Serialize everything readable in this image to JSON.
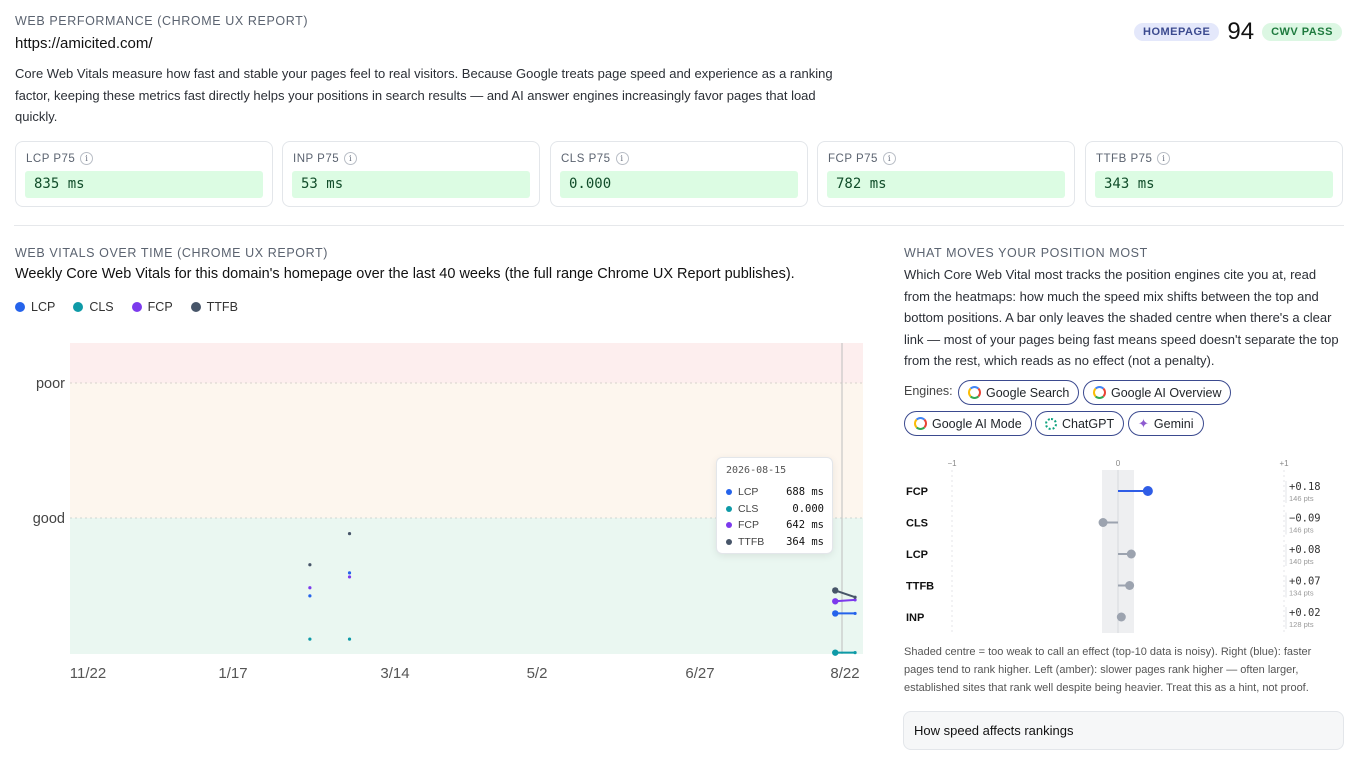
{
  "header": {
    "eyebrow": "WEB PERFORMANCE (CHROME UX REPORT)",
    "url": "https://amicited.com/",
    "badge_homepage": "HOMEPAGE",
    "score": "94",
    "badge_status": "CWV PASS",
    "intro": "Core Web Vitals measure how fast and stable your pages feel to real visitors. Because Google treats page speed and experience as a ranking factor, keeping these metrics fast directly helps your positions in search results — and AI answer engines increasingly favor pages that load quickly."
  },
  "metrics": [
    {
      "label": "LCP P75",
      "value": "835 ms"
    },
    {
      "label": "INP P75",
      "value": "53 ms"
    },
    {
      "label": "CLS P75",
      "value": "0.000"
    },
    {
      "label": "FCP P75",
      "value": "782 ms"
    },
    {
      "label": "TTFB P75",
      "value": "343 ms"
    }
  ],
  "info_glyph": "i",
  "timeseries": {
    "eyebrow": "WEB VITALS OVER TIME (CHROME UX REPORT)",
    "title": "Weekly Core Web Vitals for this domain's homepage over the last 40 weeks (the full range Chrome UX Report publishes).",
    "legend": [
      {
        "name": "LCP",
        "color": "#2563eb"
      },
      {
        "name": "CLS",
        "color": "#0e9aa7"
      },
      {
        "name": "FCP",
        "color": "#7c3aed"
      },
      {
        "name": "TTFB",
        "color": "#475569"
      }
    ],
    "band_labels": {
      "poor": "poor",
      "good": "good"
    },
    "x_ticks": [
      "11/22",
      "1/17",
      "3/14",
      "5/2",
      "6/27",
      "8/22"
    ],
    "tooltip": {
      "date": "2026-08-15",
      "rows": [
        {
          "name": "LCP",
          "value": "688 ms",
          "color": "#2563eb"
        },
        {
          "name": "CLS",
          "value": "0.000",
          "color": "#0e9aa7"
        },
        {
          "name": "FCP",
          "value": "642 ms",
          "color": "#7c3aed"
        },
        {
          "name": "TTFB",
          "value": "364 ms",
          "color": "#475569"
        }
      ]
    }
  },
  "chart_data": {
    "type": "scatter",
    "title": "",
    "x_ticks": [
      "11/22",
      "1/17",
      "3/14",
      "5/2",
      "6/27",
      "8/22"
    ],
    "x_range_weeks": [
      0,
      40
    ],
    "y_scale": "rating (good threshold = 1, poor threshold = 2)",
    "ylim": [
      0,
      2.3
    ],
    "series": [
      {
        "name": "LCP",
        "points": [
          [
            12.1,
            0.43
          ],
          [
            14.1,
            0.6
          ],
          [
            38.6,
            0.3
          ],
          [
            39.6,
            0.3
          ]
        ]
      },
      {
        "name": "CLS",
        "points": [
          [
            12.1,
            0.11
          ],
          [
            14.1,
            0.11
          ],
          [
            38.6,
            0.01
          ],
          [
            39.6,
            0.01
          ]
        ]
      },
      {
        "name": "FCP",
        "points": [
          [
            12.1,
            0.49
          ],
          [
            14.1,
            0.57
          ],
          [
            38.6,
            0.39
          ],
          [
            39.6,
            0.4
          ]
        ]
      },
      {
        "name": "TTFB",
        "points": [
          [
            12.1,
            0.66
          ],
          [
            14.1,
            0.89
          ],
          [
            38.6,
            0.47
          ],
          [
            39.6,
            0.42
          ]
        ]
      }
    ]
  },
  "position": {
    "eyebrow": "WHAT MOVES YOUR POSITION MOST",
    "body": "Which Core Web Vital most tracks the position engines cite you at, read from the heatmaps: how much the speed mix shifts between the top and bottom positions. A bar only leaves the shaded centre when there's a clear link — most of your pages being fast means speed doesn't separate the top from the rest, which reads as no effect (not a penalty).",
    "engines_label": "Engines:",
    "engines": [
      {
        "name": "Google Search",
        "icon": "google-icon"
      },
      {
        "name": "Google AI Overview",
        "icon": "google-icon"
      },
      {
        "name": "Google AI Mode",
        "icon": "google-icon"
      },
      {
        "name": "ChatGPT",
        "icon": "chatgpt-icon"
      },
      {
        "name": "Gemini",
        "icon": "gemini-icon"
      }
    ],
    "axis": {
      "min_label": "−1",
      "mid_label": "0",
      "max_label": "+1"
    },
    "rows": [
      {
        "metric": "FCP",
        "effect": 0.18,
        "effect_label": "+0.18",
        "pts": "146 pts",
        "color": "#2f5de6"
      },
      {
        "metric": "CLS",
        "effect": -0.09,
        "effect_label": "−0.09",
        "pts": "146 pts",
        "color": "#9ca3af"
      },
      {
        "metric": "LCP",
        "effect": 0.08,
        "effect_label": "+0.08",
        "pts": "140 pts",
        "color": "#9ca3af"
      },
      {
        "metric": "TTFB",
        "effect": 0.07,
        "effect_label": "+0.07",
        "pts": "134 pts",
        "color": "#9ca3af"
      },
      {
        "metric": "INP",
        "effect": 0.02,
        "effect_label": "+0.02",
        "pts": "128 pts",
        "color": "#9ca3af"
      }
    ],
    "footnote": "Shaded centre = too weak to call an effect (top-10 data is noisy). Right (blue): faster pages tend to rank higher. Left (amber): slower pages rank higher — often larger, established sites that rank well despite being heavier. Treat this as a hint, not proof.",
    "accordion_label": "How speed affects rankings"
  }
}
